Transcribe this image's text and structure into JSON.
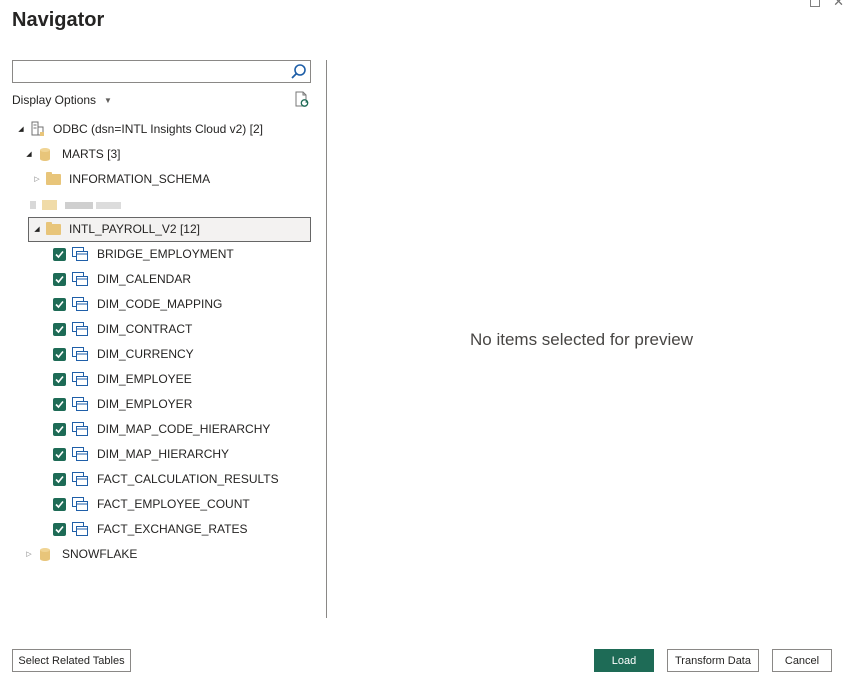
{
  "window": {
    "title": "Navigator"
  },
  "search": {
    "value": "",
    "placeholder": ""
  },
  "display_options": {
    "label": "Display Options"
  },
  "tree": {
    "root": {
      "label": "ODBC (dsn=INTL Insights Cloud v2) [2]",
      "expanded": true
    },
    "marts": {
      "label": "MARTS [3]",
      "expanded": true
    },
    "information_schema": {
      "label": "INFORMATION_SCHEMA",
      "expanded": false
    },
    "payroll": {
      "label": "INTL_PAYROLL_V2 [12]",
      "expanded": true,
      "selected": true
    },
    "tables": [
      {
        "label": "BRIDGE_EMPLOYMENT",
        "checked": true
      },
      {
        "label": "DIM_CALENDAR",
        "checked": true
      },
      {
        "label": "DIM_CODE_MAPPING",
        "checked": true
      },
      {
        "label": "DIM_CONTRACT",
        "checked": true
      },
      {
        "label": "DIM_CURRENCY",
        "checked": true
      },
      {
        "label": "DIM_EMPLOYEE",
        "checked": true
      },
      {
        "label": "DIM_EMPLOYER",
        "checked": true
      },
      {
        "label": "DIM_MAP_CODE_HIERARCHY",
        "checked": true
      },
      {
        "label": "DIM_MAP_HIERARCHY",
        "checked": true
      },
      {
        "label": "FACT_CALCULATION_RESULTS",
        "checked": true
      },
      {
        "label": "FACT_EMPLOYEE_COUNT",
        "checked": true
      },
      {
        "label": "FACT_EXCHANGE_RATES",
        "checked": true
      }
    ],
    "snowflake": {
      "label": "SNOWFLAKE",
      "expanded": false
    }
  },
  "preview": {
    "empty_message": "No items selected for preview"
  },
  "buttons": {
    "select_related": "Select Related Tables",
    "load": "Load",
    "transform": "Transform Data",
    "cancel": "Cancel"
  },
  "colors": {
    "accent": "#1e6b56",
    "folder": "#e8c57a",
    "database": "#e8c57a"
  }
}
